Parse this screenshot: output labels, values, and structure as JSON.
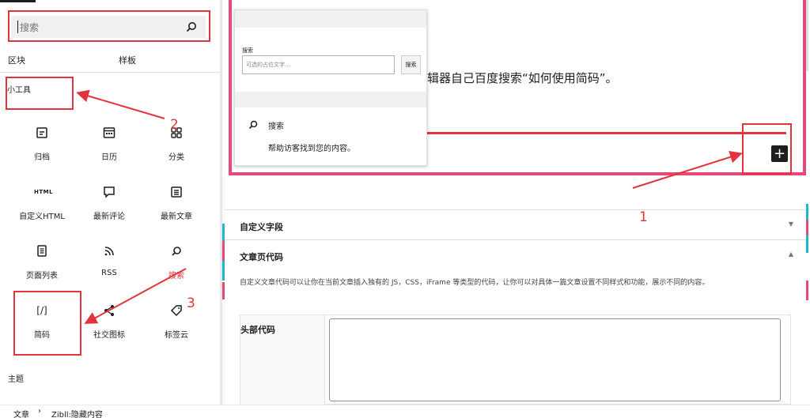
{
  "inserter": {
    "search_placeholder": "搜索",
    "tabs": [
      "区块",
      "样板"
    ],
    "categories": {
      "widgets": "小工具",
      "theme": "主题"
    },
    "blocks": [
      {
        "label": "归档",
        "icon": "archive-icon"
      },
      {
        "label": "日历",
        "icon": "calendar-icon"
      },
      {
        "label": "分类",
        "icon": "categories-icon"
      },
      {
        "label": "自定义HTML",
        "icon": "html-icon",
        "icon_text": "HTML"
      },
      {
        "label": "最新评论",
        "icon": "comment-icon"
      },
      {
        "label": "最新文章",
        "icon": "post-list-icon"
      },
      {
        "label": "页面列表",
        "icon": "page-list-icon"
      },
      {
        "label": "RSS",
        "icon": "rss-icon"
      },
      {
        "label": "搜索",
        "icon": "search-icon",
        "highlighted": true
      },
      {
        "label": "简码",
        "icon": "shortcode-icon",
        "icon_text": "[/]"
      },
      {
        "label": "社交图标",
        "icon": "share-icon"
      },
      {
        "label": "标签云",
        "icon": "tag-icon"
      }
    ]
  },
  "preview": {
    "field_label": "搜索",
    "input_placeholder": "可选的占位文字…",
    "button_label": "搜索",
    "block_title": "搜索",
    "block_description": "帮助访客找到您的内容。"
  },
  "editor": {
    "paragraph_text": "辑器自己百度搜索“如何使用简码”。",
    "add_block_symbol": "+"
  },
  "meta": {
    "custom_fields_title": "自定义字段",
    "custom_fields_arrow": "▼",
    "post_code_title": "文章页代码",
    "post_code_arrow": "▲",
    "post_code_description": "自定义文章代码可以让你在当前文章插入独有的 JS，CSS，iFrame 等类型的代码，让你可以对具体一篇文章设置不同样式和功能，展示不同的内容。",
    "head_code_label": "头部代码"
  },
  "breadcrumb": {
    "items": [
      "文章",
      "Zibll:隐藏内容"
    ],
    "separator": "›"
  },
  "annotations": [
    "1",
    "2",
    "3"
  ],
  "colors": {
    "annotation": "#e3343d",
    "editor_border": "#e8487a",
    "accent_cyan": "#1fb6d4",
    "accent_pink": "#e8487a"
  }
}
